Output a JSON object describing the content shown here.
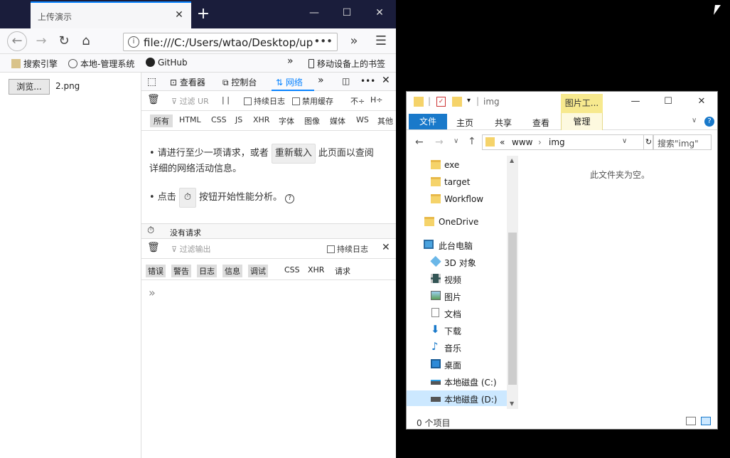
{
  "firefox": {
    "tab_title": "上传演示",
    "url": "file:///C:/Users/wtao/Desktop/up",
    "url_more": "•••",
    "bookmarks": [
      "搜索引擎",
      "本地-管理系统",
      "GitHub"
    ],
    "mobile_bookmarks": "移动设备上的书签",
    "overflow": "»"
  },
  "page": {
    "browse_label": "浏览...",
    "file_name": "2.png"
  },
  "devtools": {
    "tabs": [
      "查看器",
      "控制台",
      "网络"
    ],
    "net_toolbar": {
      "filter_placeholder": "过滤 UR",
      "pause": "| |",
      "persist_logs": "持续日志",
      "disable_cache": "禁用缓存",
      "throttle": "不",
      "har": "H"
    },
    "filters": [
      "所有",
      "HTML",
      "CSS",
      "JS",
      "XHR",
      "字体",
      "图像",
      "媒体",
      "WS",
      "其他"
    ],
    "empty": {
      "line1_prefix": "• 请进行至少一项请求，或者",
      "reload_button": "重新载入",
      "line1_suffix": "此页面以查阅",
      "line2": "详细的网络活动信息。",
      "line3_prefix": "• 点击",
      "line3_suffix": "按钮开始性能分析。"
    },
    "status": "没有请求",
    "console": {
      "filter_placeholder": "过滤输出",
      "persist_logs": "持续日志",
      "levels": [
        "错误",
        "警告",
        "日志",
        "信息",
        "调试"
      ],
      "extras": [
        "CSS",
        "XHR",
        "请求"
      ],
      "prompt": "»"
    }
  },
  "explorer": {
    "title_path": "img",
    "context_tab": "图片工...",
    "ribbon": [
      "文件",
      "主页",
      "共享",
      "查看"
    ],
    "manage_tab": "管理",
    "address": [
      "«",
      "www",
      "›",
      "img"
    ],
    "search_placeholder": "搜索\"img\"",
    "tree": [
      {
        "label": "exe",
        "kind": "folder"
      },
      {
        "label": "target",
        "kind": "folder"
      },
      {
        "label": "Workflow",
        "kind": "folder"
      },
      {
        "label": "OneDrive",
        "kind": "folder"
      },
      {
        "label": "此台电脑",
        "kind": "pc"
      },
      {
        "label": "3D 对象",
        "kind": "3d"
      },
      {
        "label": "视频",
        "kind": "video"
      },
      {
        "label": "图片",
        "kind": "picture"
      },
      {
        "label": "文档",
        "kind": "doc"
      },
      {
        "label": "下载",
        "kind": "download"
      },
      {
        "label": "音乐",
        "kind": "music"
      },
      {
        "label": "桌面",
        "kind": "desktop"
      },
      {
        "label": "本地磁盘 (C:)",
        "kind": "drive"
      },
      {
        "label": "本地磁盘 (D:)",
        "kind": "drive"
      }
    ],
    "empty_message": "此文件夹为空。",
    "status": "0 个项目"
  }
}
